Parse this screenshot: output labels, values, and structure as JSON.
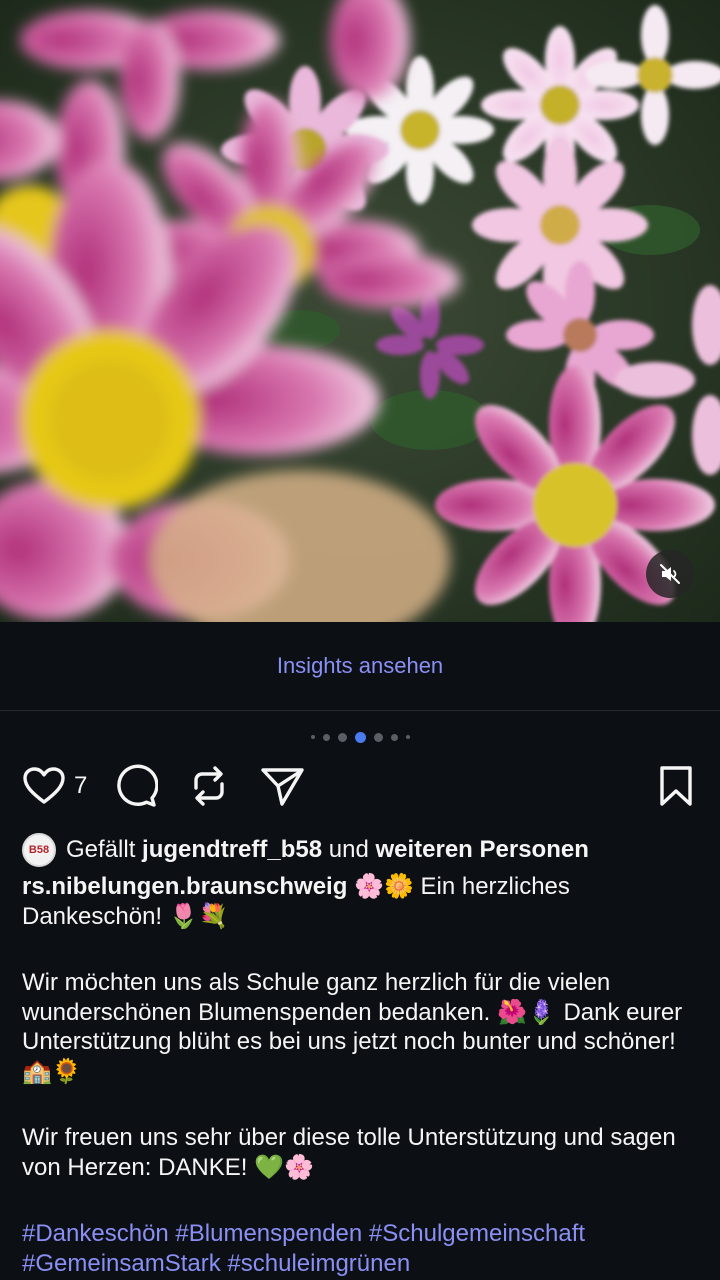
{
  "media": {
    "mute_icon": "speaker-muted-icon"
  },
  "insights": {
    "label": "Insights ansehen"
  },
  "carousel": {
    "count": 7,
    "active_index": 3
  },
  "actions": {
    "like_icon": "heart-icon",
    "like_count": "7",
    "comment_icon": "comment-icon",
    "repost_icon": "repost-icon",
    "share_icon": "paper-plane-icon",
    "save_icon": "bookmark-icon"
  },
  "liked_by": {
    "prefix": "Gefällt",
    "user": "jugendtreff_b58",
    "middle": "und",
    "others": "weiteren Personen",
    "avatar_text": "B58"
  },
  "caption": {
    "username": "rs.nibelungen.braunschweig",
    "line1": "🌸🌼 Ein herzliches Dankeschön! 🌷💐",
    "para2": "Wir möchten uns als Schule ganz herzlich für die vielen wunderschönen Blumenspenden bedanken. 🌺🪻 Dank eurer Unterstützung blüht es bei uns jetzt noch bunter und schöner! 🏫🌻",
    "para3": "Wir freuen uns sehr über diese tolle Unterstützung und sagen von Herzen: DANKE! 💚🌸",
    "hashtags": "#Dankeschön #Blumenspenden #Schulgemeinschaft #GemeinsamStark #schuleimgrünen"
  }
}
